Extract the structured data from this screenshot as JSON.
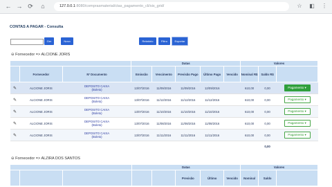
{
  "browser": {
    "url_host": "127.0.0.1",
    "url_path": ":8080/comprasmaterial/ctas_pagamento_cli/sis_grid/",
    "back": "←",
    "forward": "→",
    "reload": "⟳",
    "home": "⌂"
  },
  "page": {
    "title": "CONTAS A PAGAR - Consulta",
    "search_value": "",
    "buttons": {
      "search": "Ger",
      "new": "Novo",
      "relatorio": "Relatório",
      "filtro": "Filtro",
      "exportar": "Exportar"
    }
  },
  "sections": [
    {
      "title": "Fornecedor => ALCIONE JORIS",
      "group_headers": {
        "datas": "Datas",
        "valores": "Valores"
      },
      "headers": {
        "fornecedor": "Fornecedor",
        "documento": "Nº Documento",
        "emissao": "Emissão",
        "vencimento": "Vencimento",
        "previsao": "Previsão Pago",
        "ultimo": "Último Pago",
        "vencido": "Vencido",
        "nominal": "Nominal R$",
        "saldo": "Saldo R$"
      },
      "rows": [
        {
          "fornecedor": "ALCIONE JORIS",
          "doc": "DEPOSITO CAIXA",
          "doc_sub": "(Boleto)",
          "emissao": "13/07/2016",
          "vencimento": "11/09/2016",
          "previsao": "11/09/2016",
          "ultimo": "12/09/2016",
          "vencido": "",
          "nominal": "610,00",
          "saldo": "0,00",
          "action": "Pagamento"
        },
        {
          "fornecedor": "ALCIONE JORIS",
          "doc": "DEPOSITO CAIXA",
          "doc_sub": "(Boleto)",
          "emissao": "13/07/2016",
          "vencimento": "11/12/2016",
          "previsao": "11/12/2016",
          "ultimo": "11/12/2016",
          "vencido": "",
          "nominal": "610,00",
          "saldo": "0,00",
          "action": "Pagamento"
        },
        {
          "fornecedor": "ALCIONE JORIS",
          "doc": "DEPOSITO CAIXA",
          "doc_sub": "(Boleto)",
          "emissao": "13/07/2016",
          "vencimento": "11/10/2016",
          "previsao": "11/10/2016",
          "ultimo": "11/10/2016",
          "vencido": "",
          "nominal": "610,00",
          "saldo": "0,00",
          "action": "Pagamento"
        },
        {
          "fornecedor": "ALCIONE JORIS",
          "doc": "DEPOSITO CAIXA",
          "doc_sub": "(Boleto)",
          "emissao": "13/07/2016",
          "vencimento": "11/08/2016",
          "previsao": "11/08/2016",
          "ultimo": "11/08/2016",
          "vencido": "",
          "nominal": "610,00",
          "saldo": "0,00",
          "action": "Pagamento"
        },
        {
          "fornecedor": "ALCIONE JORIS",
          "doc": "DEPOSITO CAIXA",
          "doc_sub": "(Boleto)",
          "emissao": "13/07/2016",
          "vencimento": "11/11/2016",
          "previsao": "11/11/2016",
          "ultimo": "11/11/2016",
          "vencido": "",
          "nominal": "610,00",
          "saldo": "0,00",
          "action": "Pagamento"
        }
      ],
      "total_saldo": "0,00"
    },
    {
      "title": "Fornecedor => ALZIRA DOS SANTOS",
      "group_headers": {
        "datas": "Datas",
        "valores": "Valores"
      },
      "headers": {
        "previsao": "Previsão",
        "ultimo": "Último",
        "vencido": "Vencido",
        "nominal": "Nominal",
        "saldo": "Saldo"
      }
    }
  ]
}
